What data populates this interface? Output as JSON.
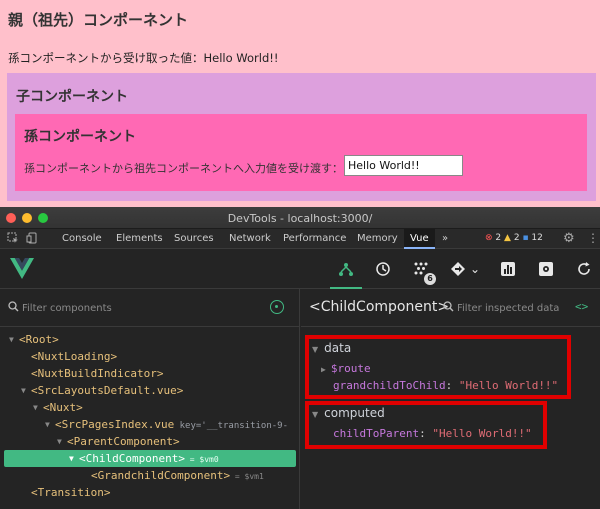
{
  "app": {
    "parent_title": "親（祖先）コンポーネント",
    "parent_text": "孫コンポーネントから受け取った値：Hello World!!",
    "child_title": "子コンポーネント",
    "grand_title": "孫コンポーネント",
    "grand_label": "孫コンポーネントから祖先コンポーネントへ入力値を受け渡す：",
    "grand_input_value": "Hello World!!"
  },
  "devtools": {
    "window_title": "DevTools - localhost:3000/",
    "tabs": [
      "Console",
      "Elements",
      "Sources",
      "Network",
      "Performance",
      "Memory",
      "Vue"
    ],
    "active_tab": "Vue",
    "more_tabs": "»",
    "errors": "2",
    "warnings": "2",
    "messages": "12",
    "vue_toolbar": {
      "icons": [
        "components-icon",
        "history-icon",
        "performance-icon",
        "routing-icon",
        "chart-icon",
        "settings-icon",
        "refresh-icon"
      ],
      "perf_count": "6",
      "routing_chevron": "⌄"
    },
    "component_search_placeholder": "Filter components",
    "tree": [
      {
        "label": "<Root>",
        "arrow": "▼"
      },
      {
        "label": "<NuxtLoading>",
        "arrow": ""
      },
      {
        "label": "<NuxtBuildIndicator>",
        "arrow": ""
      },
      {
        "label": "<SrcLayoutsDefault.vue>",
        "arrow": "▼"
      },
      {
        "label": "<Nuxt>",
        "arrow": "▼"
      },
      {
        "label": "<SrcPagesIndex.vue",
        "attr": " key='__transition-9-",
        "arrow": "▼"
      },
      {
        "label": "<ParentComponent>",
        "arrow": "▼"
      },
      {
        "label": "<ChildComponent>",
        "vm": " = $vm0",
        "arrow": "▼"
      },
      {
        "label": "<GrandchildComponent>",
        "vm": " = $vm1",
        "arrow": ""
      },
      {
        "label": "<Transition>",
        "arrow": ""
      }
    ],
    "inspect_title": "<ChildComponent>",
    "inspect_search_placeholder": "Filter inspected data",
    "code_icon_text": "<>",
    "data_section": {
      "title": "data",
      "route_key": "$route",
      "prop_key": "grandchildToChild",
      "prop_value": "\"Hello World!!\""
    },
    "computed_section": {
      "title": "computed",
      "prop_key": "childToParent",
      "prop_value": "\"Hello World!!\""
    },
    "highlight_color": "#e00000",
    "accent_color": "#42b983"
  }
}
